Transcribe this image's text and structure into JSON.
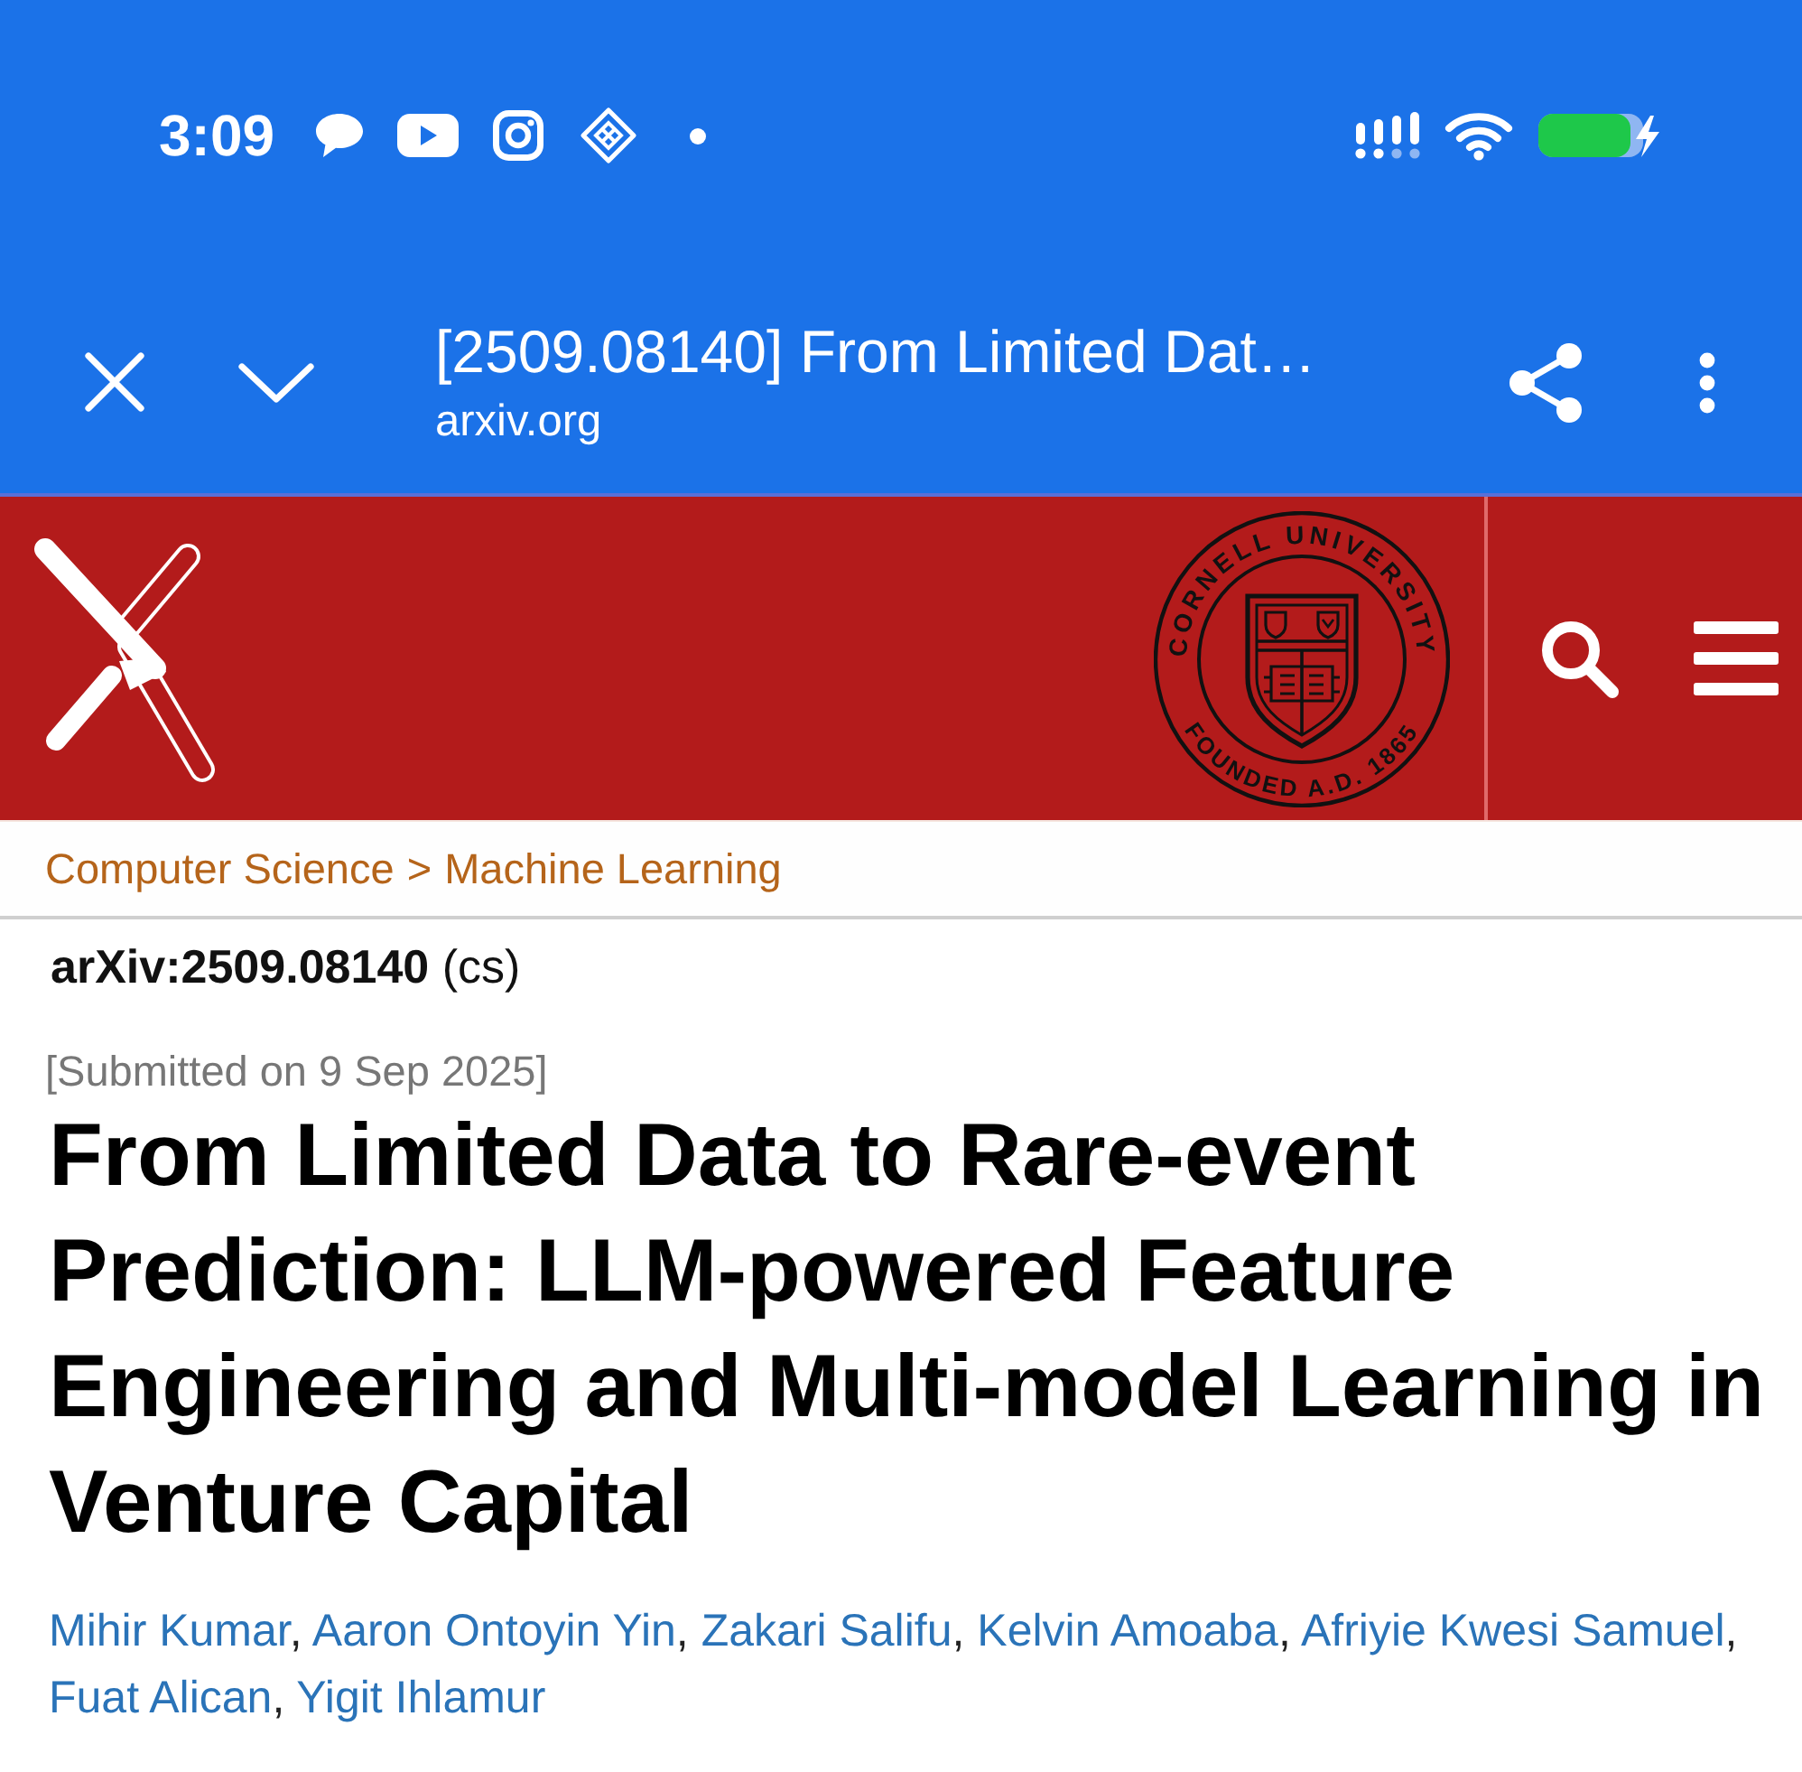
{
  "status_bar": {
    "time": "3:09"
  },
  "browser_toolbar": {
    "page_title": "[2509.08140] From Limited Dat…",
    "domain": "arxiv.org"
  },
  "site_header": {
    "seal": {
      "top_text": "CORNELL UNIVERSITY",
      "bottom_text": "FOUNDED A.D. 1865"
    }
  },
  "breadcrumb": {
    "items": [
      "Computer Science",
      "Machine Learning"
    ],
    "separator": ">"
  },
  "paper": {
    "identifier": "**arXiv:2509.08140** (cs)",
    "submitted": "[Submitted on 9 Sep 2025]",
    "title": "From Limited Data to Rare-event Prediction: LLM-powered Feature Engineering and Multi-model Learning in Venture Capital",
    "authors": [
      "Mihir Kumar",
      "Aaron Ontoyin Yin",
      "Zakari Salifu",
      "Kelvin Amoaba",
      "Afriyie Kwesi Samuel",
      "Fuat Alican",
      "Yigit Ihlamur"
    ],
    "author_separator": ","
  }
}
